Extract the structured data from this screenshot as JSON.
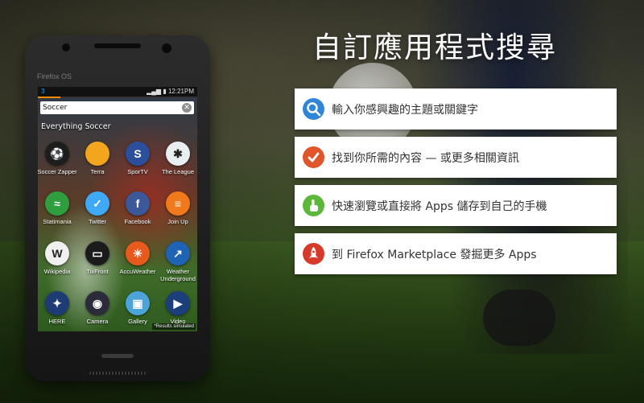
{
  "phone": {
    "brand": "Firefox OS",
    "status": {
      "notification": "3",
      "signal": "▂▄▆",
      "time": "12:21",
      "time_suffix": "PM"
    },
    "search": {
      "value": "Soccer",
      "clear_icon": "clear-icon"
    },
    "collection_title": "Everything Soccer",
    "apps": [
      {
        "label": "Soccer Zapper",
        "color": "#1d1d1d",
        "glyph": "⚽"
      },
      {
        "label": "Terra",
        "color": "#f3a51d",
        "glyph": ""
      },
      {
        "label": "SporTV",
        "color": "#2b4f9c",
        "glyph": "S"
      },
      {
        "label": "The League",
        "color": "#e9eef0",
        "glyph": "✱"
      },
      {
        "label": "Statimania",
        "color": "#2e9e3e",
        "glyph": "≈"
      },
      {
        "label": "Twitter",
        "color": "#3fa9f5",
        "glyph": "✓"
      },
      {
        "label": "Facebook",
        "color": "#3b5998",
        "glyph": "f"
      },
      {
        "label": "Join Up",
        "color": "#f07a1b",
        "glyph": "≡"
      },
      {
        "label": "Wikipedia",
        "color": "#f0f0f0",
        "glyph": "W"
      },
      {
        "label": "TixFront",
        "color": "#1b1b1b",
        "glyph": "▭"
      },
      {
        "label": "AccuWeather",
        "color": "#e85a1c",
        "glyph": "☀"
      },
      {
        "label": "Weather Underground",
        "color": "#1e63b6",
        "glyph": "↗"
      },
      {
        "label": "HERE",
        "color": "#1d3b75",
        "glyph": "✦"
      },
      {
        "label": "Camera",
        "color": "#2b2b3b",
        "glyph": "◉"
      },
      {
        "label": "Gallery",
        "color": "#4ba3d8",
        "glyph": "▣"
      },
      {
        "label": "Video",
        "color": "#1b3f7a",
        "glyph": "▶"
      }
    ],
    "note": "*Results simulated"
  },
  "title": "自訂應用程式搜尋",
  "features": [
    {
      "text": "輸入你感興趣的主題或關鍵字",
      "icon": "search-icon",
      "color": "#2f86d6"
    },
    {
      "text": "找到你所需的內容 — 或更多相關資訊",
      "icon": "check-icon",
      "color": "#e0552a"
    },
    {
      "text": "快速瀏覽或直接將 Apps 儲存到自己的手機",
      "icon": "hand-pointer-icon",
      "color": "#5cb83a"
    },
    {
      "text": "到 Firefox Marketplace 發掘更多 Apps",
      "icon": "rocket-icon",
      "color": "#d63a2a"
    }
  ]
}
